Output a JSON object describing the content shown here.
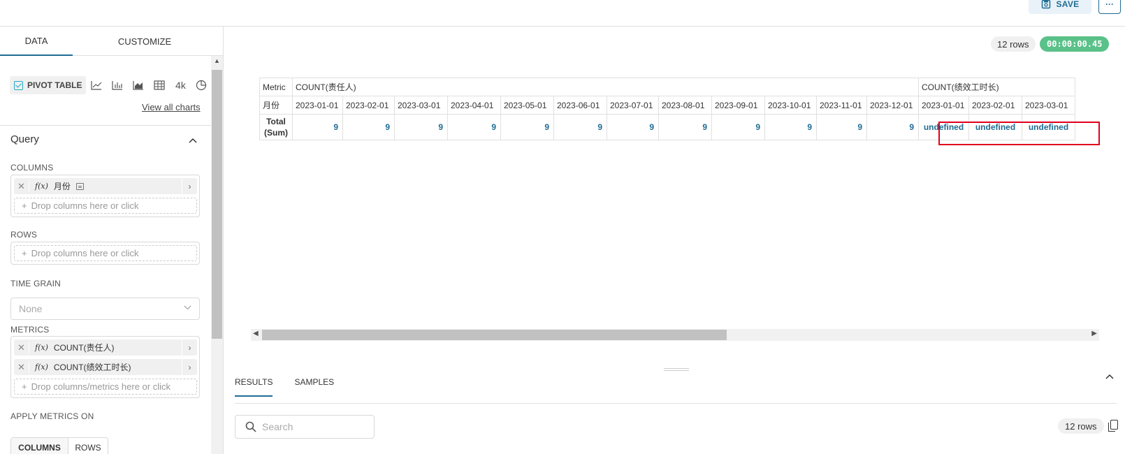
{
  "header": {
    "save_label": "SAVE",
    "more_label": "···"
  },
  "panel": {
    "tabs": [
      "DATA",
      "CUSTOMIZE"
    ],
    "viz_selected": "PIVOT TABLE",
    "viz_number_label": "4k",
    "view_all": "View all charts",
    "query_title": "Query",
    "columns_label": "COLUMNS",
    "column_item": "月份",
    "fx_symbol": "f(x)",
    "drop_columns": "Drop columns here or click",
    "rows_label": "ROWS",
    "drop_rows": "Drop columns here or click",
    "time_grain_label": "TIME GRAIN",
    "time_grain_value": "None",
    "metrics_label": "METRICS",
    "metric_1": "COUNT(责任人)",
    "metric_2": "COUNT(绩效工时长)",
    "drop_metrics": "Drop columns/metrics here or click",
    "apply_label": "APPLY METRICS ON",
    "apply_on": "COLUMNS",
    "apply_off": "ROWS"
  },
  "status": {
    "rows": "12 rows",
    "timer": "00:00:00.45"
  },
  "pivot": {
    "metric_header": "Metric",
    "month_header": "月份",
    "total_label": "Total (Sum)",
    "metric_1": "COUNT(责任人)",
    "metric_2": "COUNT(绩效工时长)",
    "dates_1": [
      "2023-01-01",
      "2023-02-01",
      "2023-03-01",
      "2023-04-01",
      "2023-05-01",
      "2023-06-01",
      "2023-07-01",
      "2023-08-01",
      "2023-09-01",
      "2023-10-01",
      "2023-11-01",
      "2023-12-01"
    ],
    "values_1": [
      "9",
      "9",
      "9",
      "9",
      "9",
      "9",
      "9",
      "9",
      "9",
      "9",
      "9",
      "9"
    ],
    "dates_2": [
      "2023-01-01",
      "2023-02-01",
      "2023-03-01"
    ],
    "values_2": [
      "undefined",
      "undefined",
      "undefined"
    ]
  },
  "results": {
    "tabs": [
      "RESULTS",
      "SAMPLES"
    ],
    "search_placeholder": "Search",
    "rows": "12 rows"
  }
}
